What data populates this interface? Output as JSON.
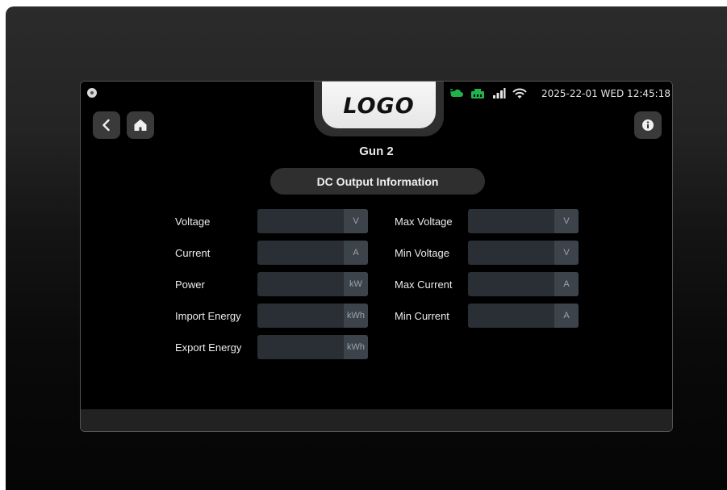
{
  "header": {
    "logo_text": "LOGO",
    "datetime": "2025-22-01 WED 12:45:18",
    "status_icons": [
      "cloud-connected-icon",
      "network-connected-icon",
      "signal-strength-icon",
      "wifi-icon"
    ],
    "status_colors": {
      "connected": "#22b24c",
      "default": "#e6e6e6"
    }
  },
  "nav": {
    "back_icon": "back-arrow-icon",
    "home_icon": "home-icon",
    "info_icon": "info-icon"
  },
  "page": {
    "title": "Gun 2",
    "section": "DC Output Information"
  },
  "left_fields": [
    {
      "label": "Voltage",
      "value": "",
      "unit": "V"
    },
    {
      "label": "Current",
      "value": "",
      "unit": "A"
    },
    {
      "label": "Power",
      "value": "",
      "unit": "kW"
    },
    {
      "label": "Import Energy",
      "value": "",
      "unit": "kWh"
    },
    {
      "label": "Export Energy",
      "value": "",
      "unit": "kWh"
    }
  ],
  "right_fields": [
    {
      "label": "Max Voltage",
      "value": "",
      "unit": "V"
    },
    {
      "label": "Min Voltage",
      "value": "",
      "unit": "V"
    },
    {
      "label": "Max Current",
      "value": "",
      "unit": "A"
    },
    {
      "label": "Min Current",
      "value": "",
      "unit": "A"
    }
  ]
}
